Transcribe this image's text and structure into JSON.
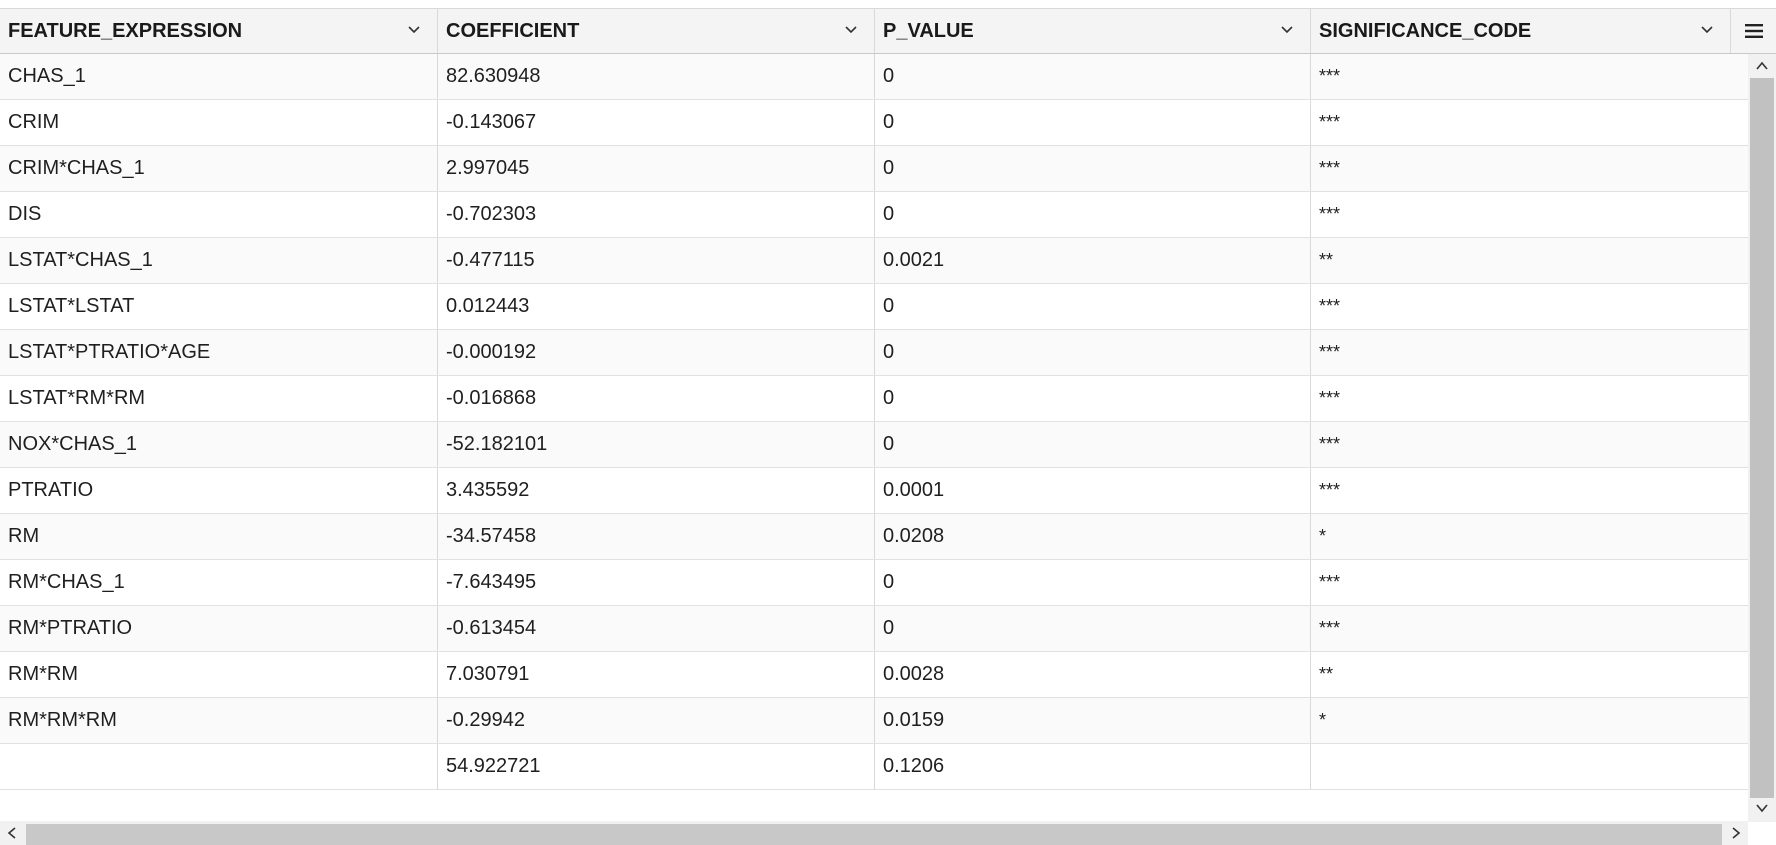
{
  "columns": [
    {
      "label": "FEATURE_EXPRESSION"
    },
    {
      "label": "COEFFICIENT"
    },
    {
      "label": "P_VALUE"
    },
    {
      "label": "SIGNIFICANCE_CODE"
    }
  ],
  "rows": [
    {
      "feature": "CHAS_1",
      "coefficient": "82.630948",
      "p_value": "0",
      "significance": "***"
    },
    {
      "feature": "CRIM",
      "coefficient": "-0.143067",
      "p_value": "0",
      "significance": "***"
    },
    {
      "feature": "CRIM*CHAS_1",
      "coefficient": "2.997045",
      "p_value": "0",
      "significance": "***"
    },
    {
      "feature": "DIS",
      "coefficient": "-0.702303",
      "p_value": "0",
      "significance": "***"
    },
    {
      "feature": "LSTAT*CHAS_1",
      "coefficient": "-0.477115",
      "p_value": "0.0021",
      "significance": "**"
    },
    {
      "feature": "LSTAT*LSTAT",
      "coefficient": "0.012443",
      "p_value": "0",
      "significance": "***"
    },
    {
      "feature": "LSTAT*PTRATIO*AGE",
      "coefficient": "-0.000192",
      "p_value": "0",
      "significance": "***"
    },
    {
      "feature": "LSTAT*RM*RM",
      "coefficient": "-0.016868",
      "p_value": "0",
      "significance": "***"
    },
    {
      "feature": "NOX*CHAS_1",
      "coefficient": "-52.182101",
      "p_value": "0",
      "significance": "***"
    },
    {
      "feature": "PTRATIO",
      "coefficient": "3.435592",
      "p_value": "0.0001",
      "significance": "***"
    },
    {
      "feature": "RM",
      "coefficient": "-34.57458",
      "p_value": "0.0208",
      "significance": "*"
    },
    {
      "feature": "RM*CHAS_1",
      "coefficient": "-7.643495",
      "p_value": "0",
      "significance": "***"
    },
    {
      "feature": "RM*PTRATIO",
      "coefficient": "-0.613454",
      "p_value": "0",
      "significance": "***"
    },
    {
      "feature": "RM*RM",
      "coefficient": "7.030791",
      "p_value": "0.0028",
      "significance": "**"
    },
    {
      "feature": "RM*RM*RM",
      "coefficient": "-0.29942",
      "p_value": "0.0159",
      "significance": "*"
    },
    {
      "feature": "",
      "coefficient": "54.922721",
      "p_value": "0.1206",
      "significance": ""
    }
  ],
  "icons": {
    "column_menu": "chevron-down-icon",
    "grid_menu": "hamburger-menu-icon",
    "scroll_up": "chevron-up-icon",
    "scroll_down": "chevron-down-icon",
    "scroll_left": "chevron-left-icon",
    "scroll_right": "chevron-right-icon"
  },
  "colors": {
    "header_bg": "#f4f4f4",
    "scrollbar_thumb": "#c1c1c1"
  }
}
